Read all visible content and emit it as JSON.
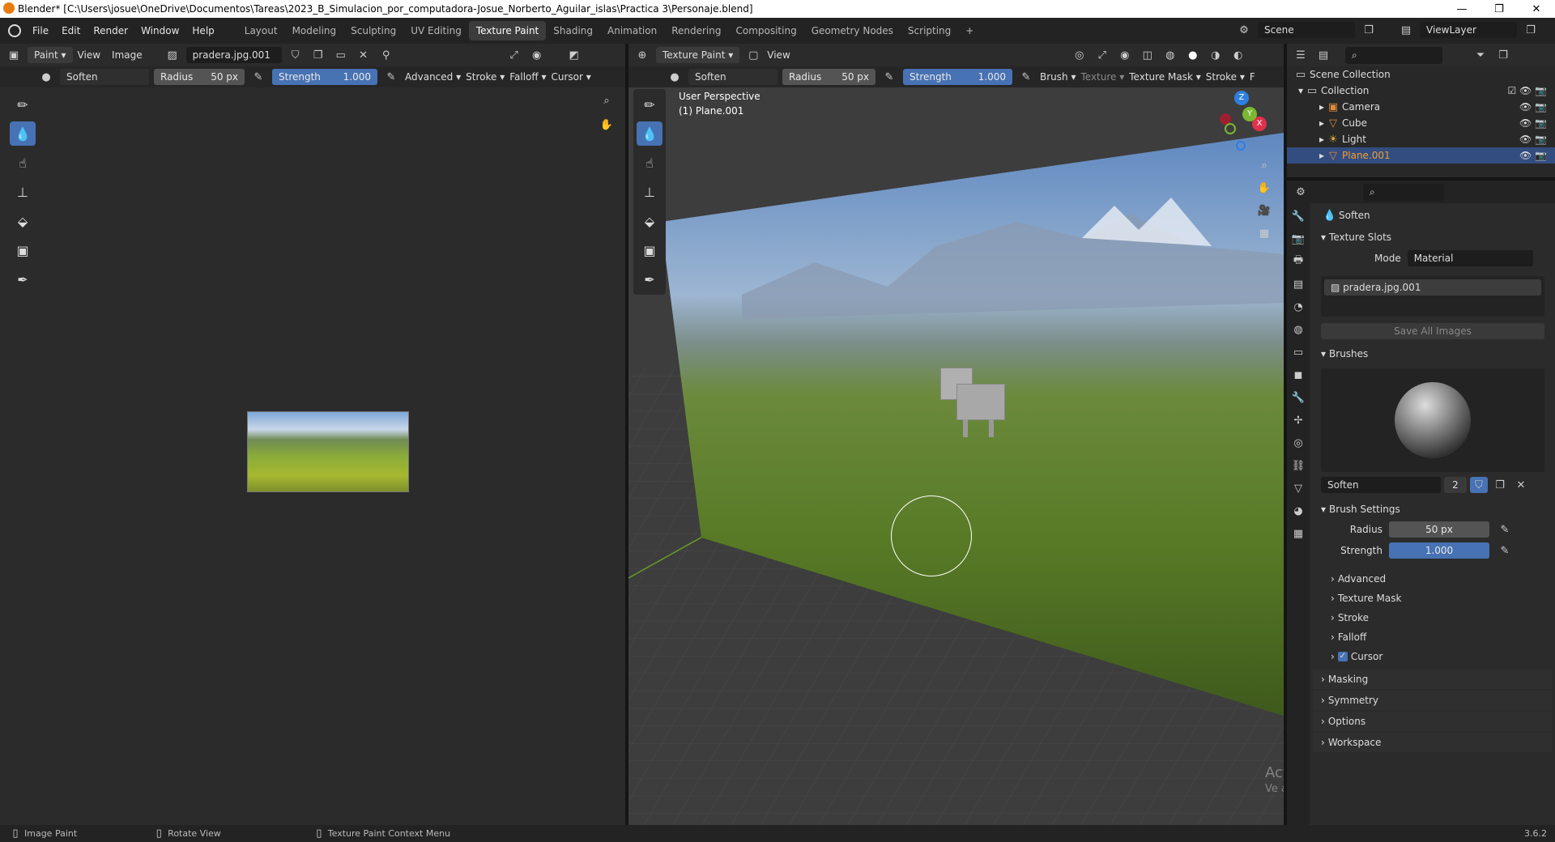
{
  "window": {
    "title": "Blender* [C:\\Users\\josue\\OneDrive\\Documentos\\Tareas\\2023_B_Simulacion_por_computadora-Josue_Norberto_Aguilar_islas\\Practica 3\\Personaje.blend]",
    "min": "—",
    "max": "❐",
    "close": "✕"
  },
  "menu": [
    "File",
    "Edit",
    "Render",
    "Window",
    "Help"
  ],
  "workspaces": [
    "Layout",
    "Modeling",
    "Sculpting",
    "UV Editing",
    "Texture Paint",
    "Shading",
    "Animation",
    "Rendering",
    "Compositing",
    "Geometry Nodes",
    "Scripting"
  ],
  "active_workspace": "Texture Paint",
  "add_workspace": "+",
  "scene": {
    "name": "Scene",
    "view_layer": "ViewLayer"
  },
  "image_editor": {
    "mode": "Paint",
    "view": "View",
    "image_menu": "Image",
    "image_name": "pradera.jpg.001",
    "brush": "Soften",
    "radius_label": "Radius",
    "radius_value": "50 px",
    "strength_label": "Strength",
    "strength_value": "1.000",
    "menus": [
      "Advanced",
      "Stroke",
      "Falloff",
      "Cursor"
    ]
  },
  "viewport": {
    "mode": "Texture Paint",
    "view": "View",
    "brush": "Soften",
    "radius_label": "Radius",
    "radius_value": "50 px",
    "strength_label": "Strength",
    "strength_value": "1.000",
    "menus": [
      "Brush",
      "Texture",
      "Texture Mask",
      "Stroke",
      "F"
    ],
    "perspective": "User Perspective",
    "object": "(1) Plane.001",
    "gizmo": {
      "z": "Z",
      "x": "X",
      "y": "Y"
    }
  },
  "outliner": {
    "root": "Scene Collection",
    "collection": "Collection",
    "items": [
      {
        "name": "Camera",
        "icon": "camera-icon",
        "color": "#d9a35a"
      },
      {
        "name": "Cube",
        "icon": "mesh-icon",
        "color": "#e08a3a"
      },
      {
        "name": "Light",
        "icon": "light-icon",
        "color": "#e0b040"
      },
      {
        "name": "Plane.001",
        "icon": "mesh-icon",
        "color": "#e08a3a"
      }
    ]
  },
  "properties": {
    "tool_title": "Soften",
    "texture_slots": "Texture Slots",
    "mode_label": "Mode",
    "mode_value": "Material",
    "slot": "pradera.jpg.001",
    "save_all": "Save All Images",
    "brushes": "Brushes",
    "brush_name": "Soften",
    "brush_users": "2",
    "brush_settings": "Brush Settings",
    "radius_label": "Radius",
    "radius_value": "50 px",
    "strength_label": "Strength",
    "strength_value": "1.000",
    "subsections": [
      "Advanced",
      "Texture Mask",
      "Stroke",
      "Falloff",
      "Cursor"
    ],
    "sections": [
      "Masking",
      "Symmetry",
      "Options",
      "Workspace"
    ]
  },
  "activation": {
    "line1": "Activar Windows",
    "line2": "Ve a Configuración para activar Windows."
  },
  "status": {
    "item1": "Image Paint",
    "item2": "Rotate View",
    "item3": "Texture Paint Context Menu",
    "version": "3.6.2"
  },
  "colors": {
    "accent": "#4772b3",
    "selected_row": "#334d80",
    "panel": "#2b2b2b",
    "viewport_bg": "#3d3d3d"
  }
}
